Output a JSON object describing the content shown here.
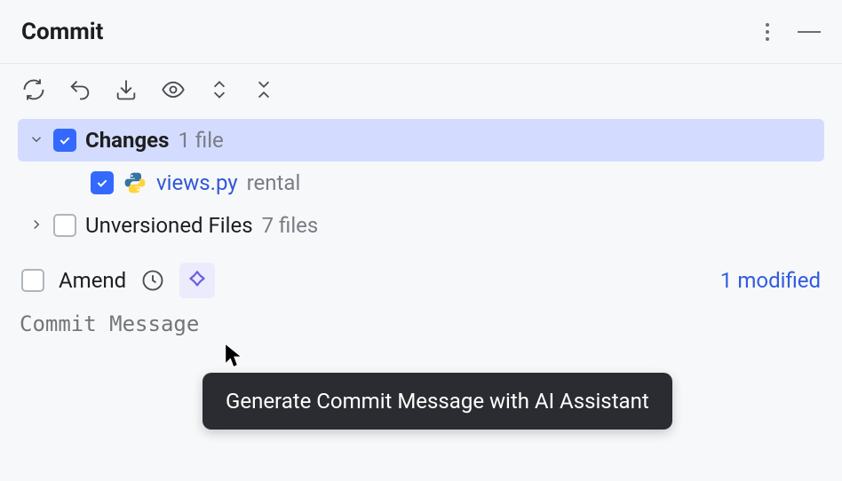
{
  "title": "Commit",
  "changes": {
    "label": "Changes",
    "count": "1 file",
    "file": {
      "name": "views.py",
      "dir": "rental"
    }
  },
  "unversioned": {
    "label": "Unversioned Files",
    "count": "7 files"
  },
  "amend": {
    "label": "Amend"
  },
  "modified": "1 modified",
  "commit_msg_placeholder": "Commit Message",
  "tooltip": "Generate Commit Message with AI Assistant"
}
